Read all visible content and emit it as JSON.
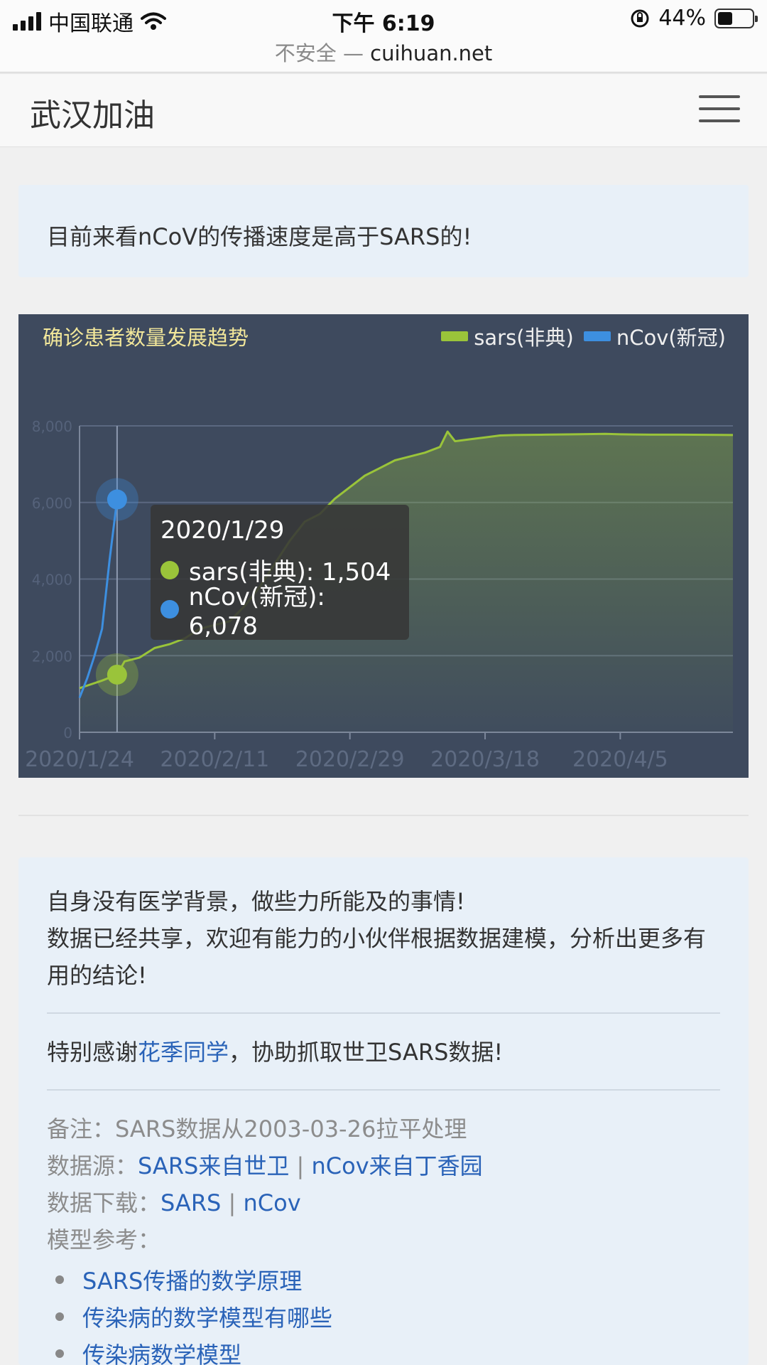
{
  "status_bar": {
    "carrier": "中国联通",
    "time": "下午 6:19",
    "battery_percent": "44%",
    "battery_level": 0.44
  },
  "browser": {
    "insecure_label": "不安全",
    "separator": "—",
    "domain": "cuihuan.net"
  },
  "navbar": {
    "brand": "武汉加油",
    "menu_icon": "hamburger-icon"
  },
  "alert": {
    "text": "目前来看nCoV的传播速度是高于SARS的!"
  },
  "chart": {
    "title": "确诊患者数量发展趋势",
    "legend": [
      {
        "label": "sars(非典)",
        "color": "#9ac43a"
      },
      {
        "label": "nCov(新冠)",
        "color": "#3d8fe0"
      }
    ],
    "tooltip": {
      "date": "2020/1/29",
      "rows": [
        {
          "text": "sars(非典): 1,504",
          "color": "#9ac43a"
        },
        {
          "text": "nCov(新冠): 6,078",
          "color": "#3d8fe0"
        }
      ]
    }
  },
  "chart_data": {
    "type": "line",
    "title": "确诊患者数量发展趋势",
    "x_tick_labels": [
      "2020/1/24",
      "2020/2/11",
      "2020/2/29",
      "2020/3/18",
      "2020/4/5"
    ],
    "y_tick_labels": [
      "0",
      "2,000",
      "4,000",
      "6,000",
      "8,000"
    ],
    "ylim": [
      0,
      8000
    ],
    "xlim_days": [
      0,
      87
    ],
    "grid": true,
    "legend_position": "top-right",
    "highlight": {
      "day": 5,
      "sars": 1504,
      "ncov": 6078
    },
    "series": [
      {
        "name": "sars(非典)",
        "color": "#9ac43a",
        "area": true,
        "points": [
          [
            0,
            1150
          ],
          [
            3,
            1350
          ],
          [
            5,
            1504
          ],
          [
            6,
            1850
          ],
          [
            8,
            1950
          ],
          [
            10,
            2200
          ],
          [
            12,
            2300
          ],
          [
            14,
            2450
          ],
          [
            16,
            2700
          ],
          [
            18,
            2800
          ],
          [
            20,
            2900
          ],
          [
            22,
            3300
          ],
          [
            24,
            3800
          ],
          [
            26,
            4400
          ],
          [
            28,
            5000
          ],
          [
            30,
            5500
          ],
          [
            32,
            5700
          ],
          [
            34,
            6100
          ],
          [
            36,
            6400
          ],
          [
            38,
            6700
          ],
          [
            40,
            6900
          ],
          [
            42,
            7100
          ],
          [
            44,
            7200
          ],
          [
            46,
            7300
          ],
          [
            48,
            7450
          ],
          [
            49,
            7850
          ],
          [
            50,
            7600
          ],
          [
            52,
            7650
          ],
          [
            54,
            7700
          ],
          [
            56,
            7750
          ],
          [
            58,
            7760
          ],
          [
            62,
            7770
          ],
          [
            66,
            7780
          ],
          [
            70,
            7790
          ],
          [
            72,
            7780
          ],
          [
            76,
            7770
          ],
          [
            80,
            7770
          ],
          [
            87,
            7760
          ]
        ]
      },
      {
        "name": "nCov(新冠)",
        "color": "#3d8fe0",
        "area": false,
        "points": [
          [
            0,
            900
          ],
          [
            1,
            1400
          ],
          [
            2,
            2000
          ],
          [
            3,
            2700
          ],
          [
            4,
            4500
          ],
          [
            5,
            6078
          ]
        ]
      }
    ]
  },
  "info": {
    "line1": "自身没有医学背景，做些力所能及的事情!",
    "line2": "数据已经共享，欢迎有能力的小伙伴根据数据建模，分析出更多有用的结论!",
    "thanks_prefix": "特别感谢",
    "thanks_link": "花季同学",
    "thanks_suffix": "，协助抓取世卫SARS数据!",
    "note": "备注：SARS数据从2003-03-26拉平处理",
    "source_label": "数据源：",
    "source_sars": "SARS来自世卫",
    "source_sep": "|",
    "source_ncov": "nCov来自丁香园",
    "download_label": "数据下载：",
    "download_sars": "SARS",
    "download_ncov": "nCov",
    "model_label": "模型参考：",
    "models": [
      "SARS传播的数学原理",
      "传染病的数学模型有哪些",
      "传染病数学模型"
    ]
  }
}
